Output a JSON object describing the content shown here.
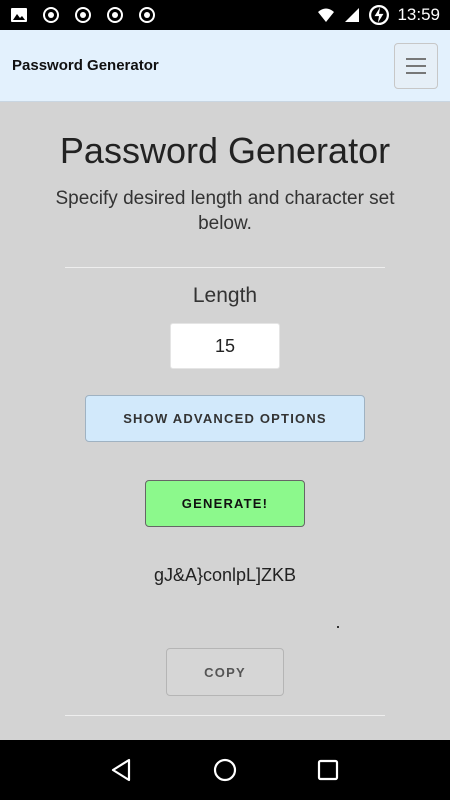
{
  "status_bar": {
    "time": "13:59",
    "left_icons": [
      "image-icon",
      "record-icon",
      "record-icon",
      "record-icon",
      "record-icon"
    ],
    "right_icons": [
      "wifi-icon",
      "signal-icon",
      "battery-charging-icon"
    ]
  },
  "navbar": {
    "brand": "Password Generator",
    "menu_icon": "hamburger-icon"
  },
  "main": {
    "title": "Password Generator",
    "subtitle": "Specify desired length and character set below.",
    "length_label": "Length",
    "length_value": "15",
    "advanced_button": "SHOW ADVANCED OPTIONS",
    "generate_button": "GENERATE!",
    "password": "gJ&A}conlpL]ZKB",
    "copy_button": "COPY"
  },
  "system_nav": {
    "back_icon": "back-triangle-icon",
    "home_icon": "home-circle-icon",
    "recents_icon": "recents-square-icon"
  },
  "colors": {
    "navbar_bg": "#e3f1fd",
    "page_bg": "#d3d3d3",
    "advanced_bg": "#d2e9fb",
    "generate_bg": "#8cf98c"
  }
}
